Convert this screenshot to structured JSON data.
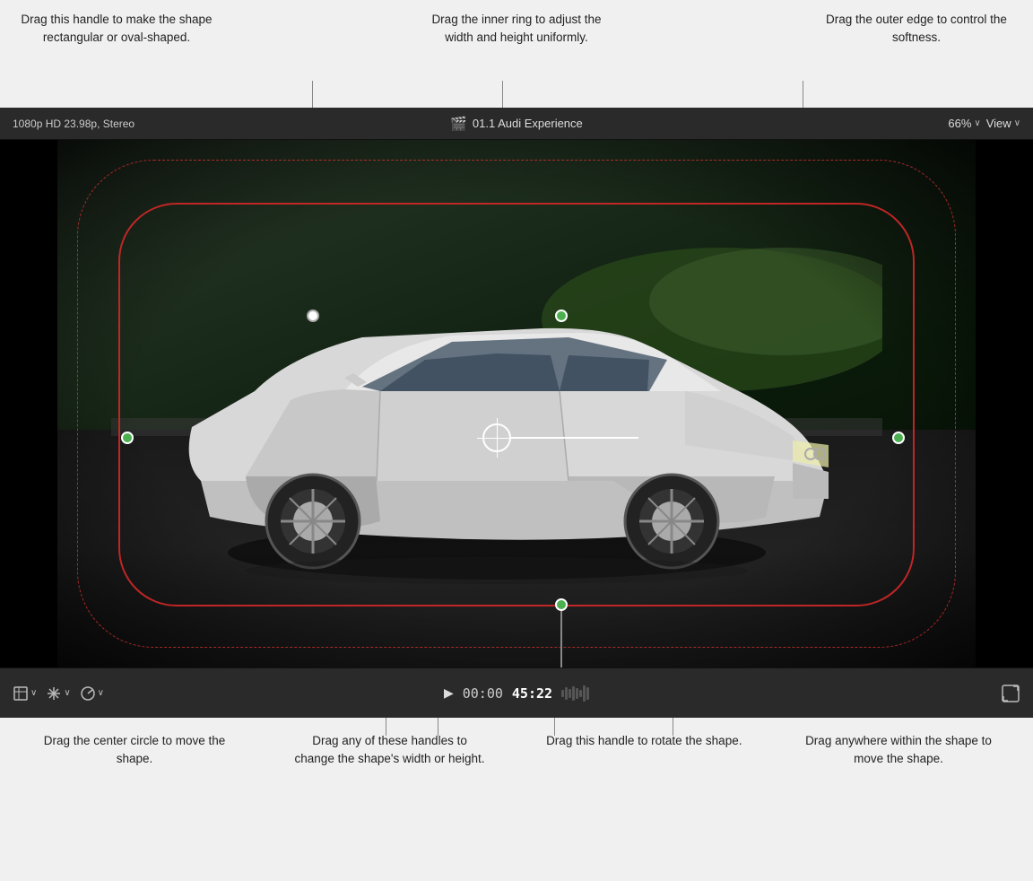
{
  "annotations": {
    "top_left": {
      "text": "Drag this handle to make the shape rectangular or oval-shaped."
    },
    "top_center": {
      "text": "Drag the inner ring to adjust the width and height uniformly."
    },
    "top_right": {
      "text": "Drag the outer edge to control the softness."
    },
    "bottom_left": {
      "text": "Drag the center circle to move the shape."
    },
    "bottom_center_left": {
      "text": "Drag any of these handles to change the shape's width or height."
    },
    "bottom_center_right": {
      "text": "Drag this handle to rotate the shape."
    },
    "bottom_right": {
      "text": "Drag anywhere within the shape to move the shape."
    }
  },
  "viewer": {
    "format_label": "1080p HD 23.98p, Stereo",
    "film_icon": "🎬",
    "title": "01.1 Audi Experience",
    "zoom_label": "66%",
    "view_label": "View"
  },
  "controls": {
    "play_button": "▶",
    "timecode_prefix": "00:00",
    "timecode_highlight": "45:22"
  },
  "icons": {
    "zoom_chevron": "∨",
    "view_chevron": "∨",
    "crop_icon": "⊡",
    "transform_icon": "⊹",
    "speed_icon": "⊙",
    "expand_icon": "⤢"
  }
}
